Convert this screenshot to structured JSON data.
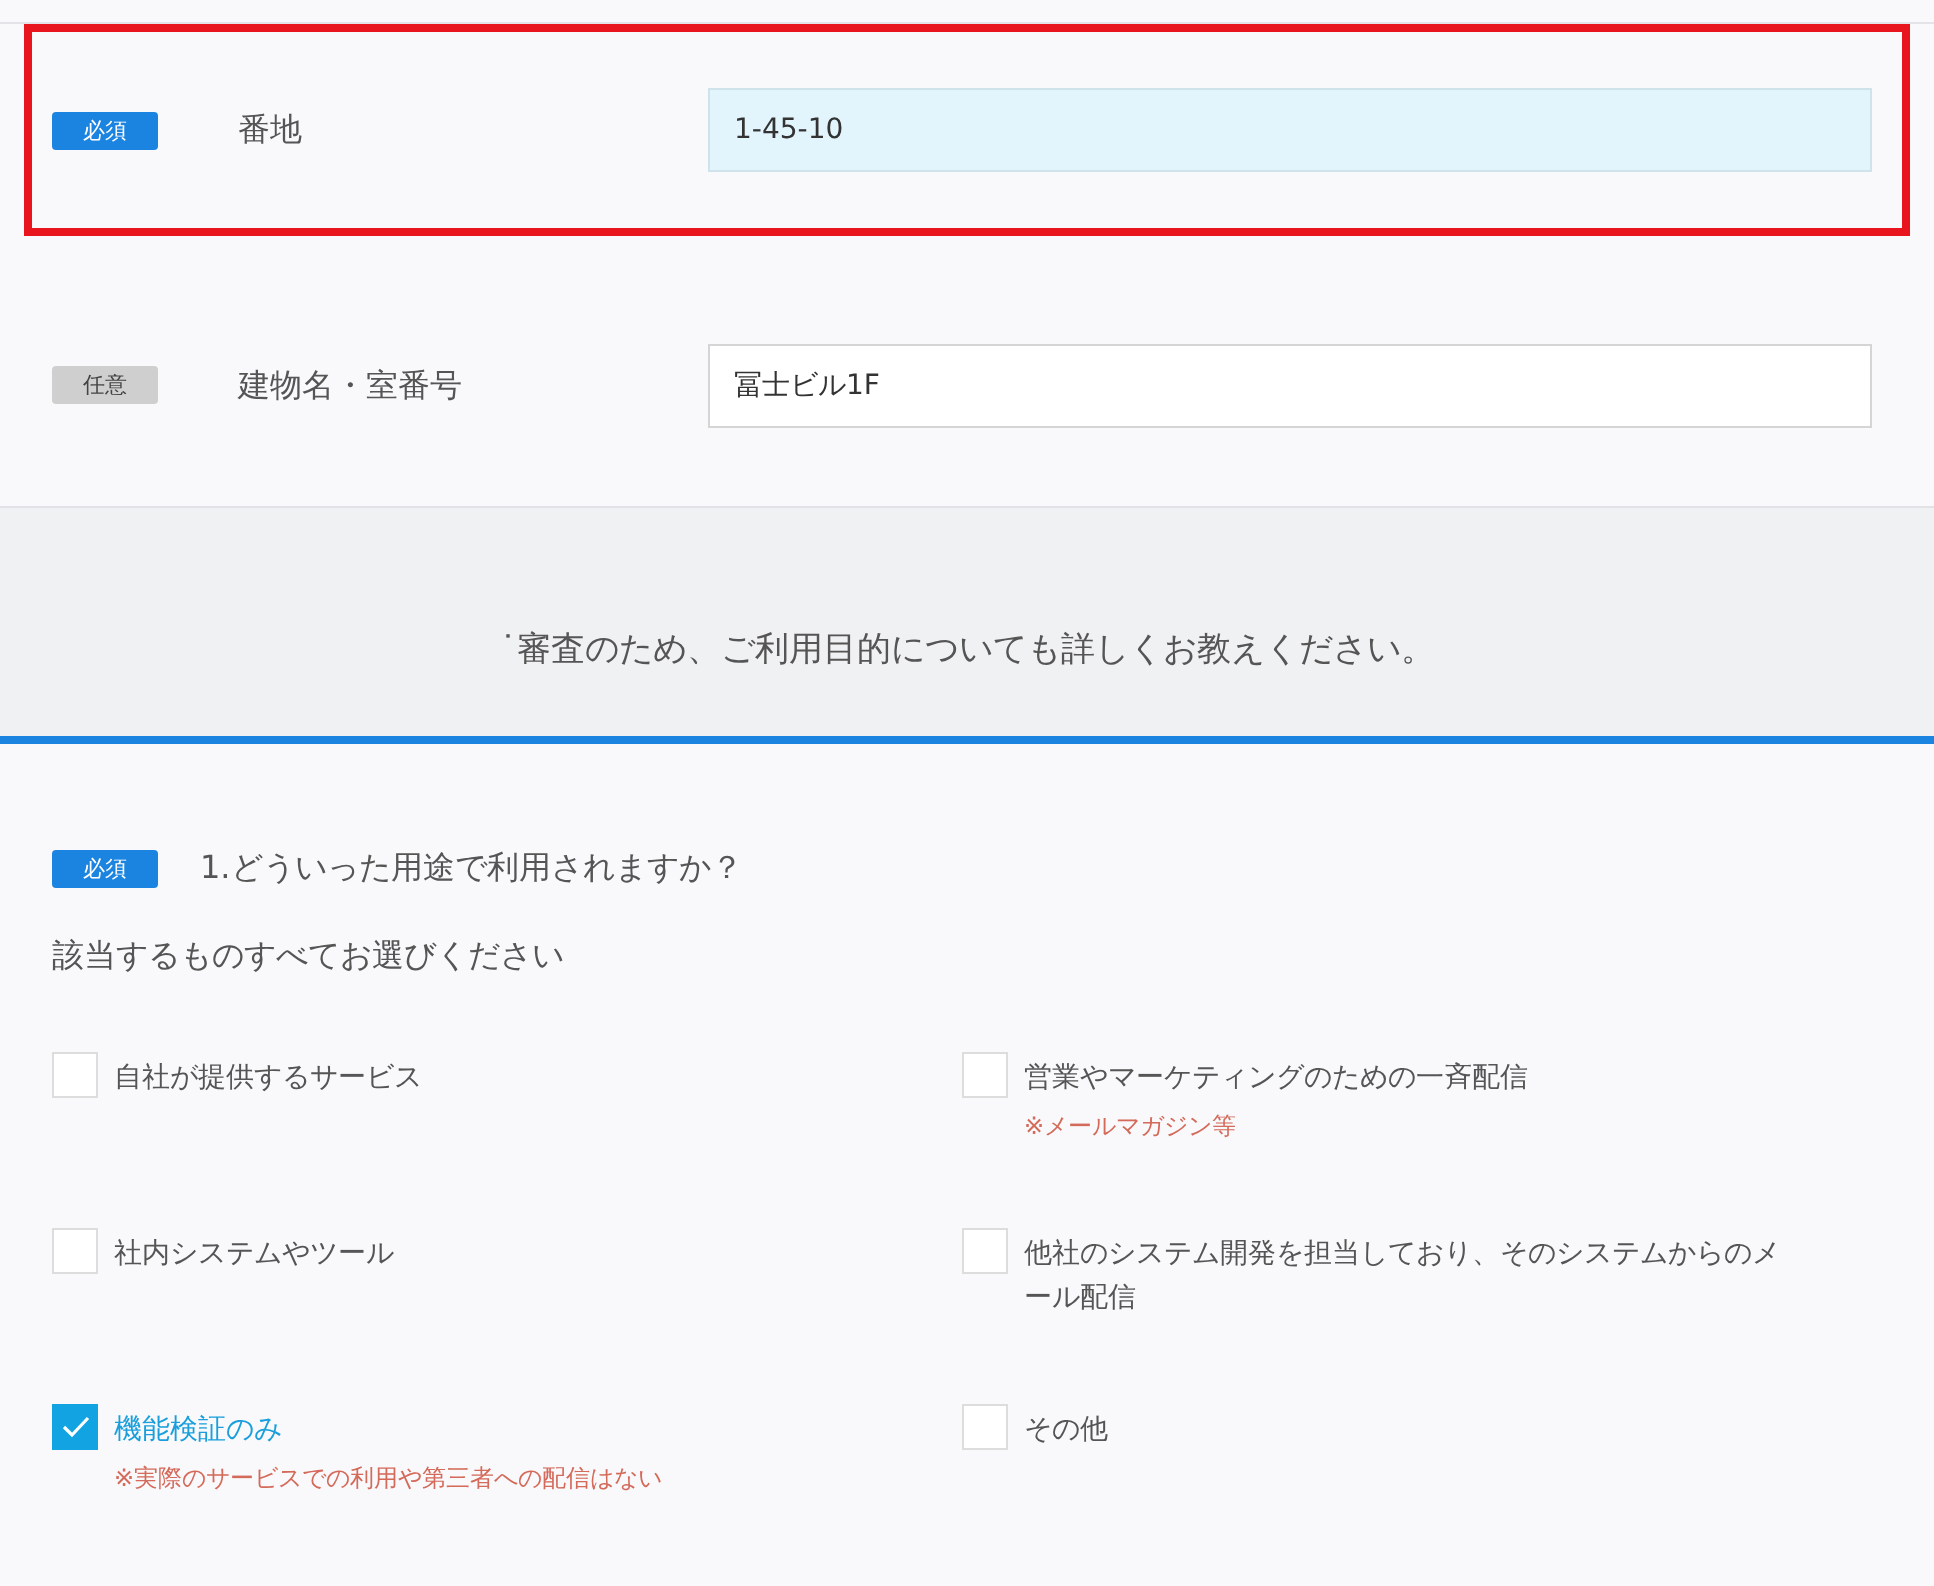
{
  "fields": [
    {
      "badge": {
        "kind": "required",
        "label": "必須"
      },
      "label": "番地",
      "value": "1-45-10",
      "focused": true,
      "highlighted": true
    },
    {
      "badge": {
        "kind": "optional",
        "label": "任意"
      },
      "label": "建物名・室番号",
      "value": "冨士ビル1F",
      "focused": false,
      "highlighted": false
    }
  ],
  "banner": "˙審査のため、ご利用目的についても詳しくお教えください。",
  "question": {
    "badge": {
      "kind": "required",
      "label": "必須"
    },
    "title": "1.どういった用途で利用されますか？",
    "instruction": "該当するものすべてお選びください",
    "options": [
      {
        "label": "自社が提供するサービス",
        "checked": false
      },
      {
        "label": "営業やマーケティングのための一斉配信",
        "checked": false,
        "note": "※メールマガジン等"
      },
      {
        "label": "社内システムやツール",
        "checked": false
      },
      {
        "label": "他社のシステム開発を担当しており、そのシステムからのメール配信",
        "checked": false
      },
      {
        "label": "機能検証のみ",
        "checked": true,
        "note": "※実際のサービスでの利用や第三者への配信はない"
      },
      {
        "label": "その他",
        "checked": false
      }
    ]
  }
}
